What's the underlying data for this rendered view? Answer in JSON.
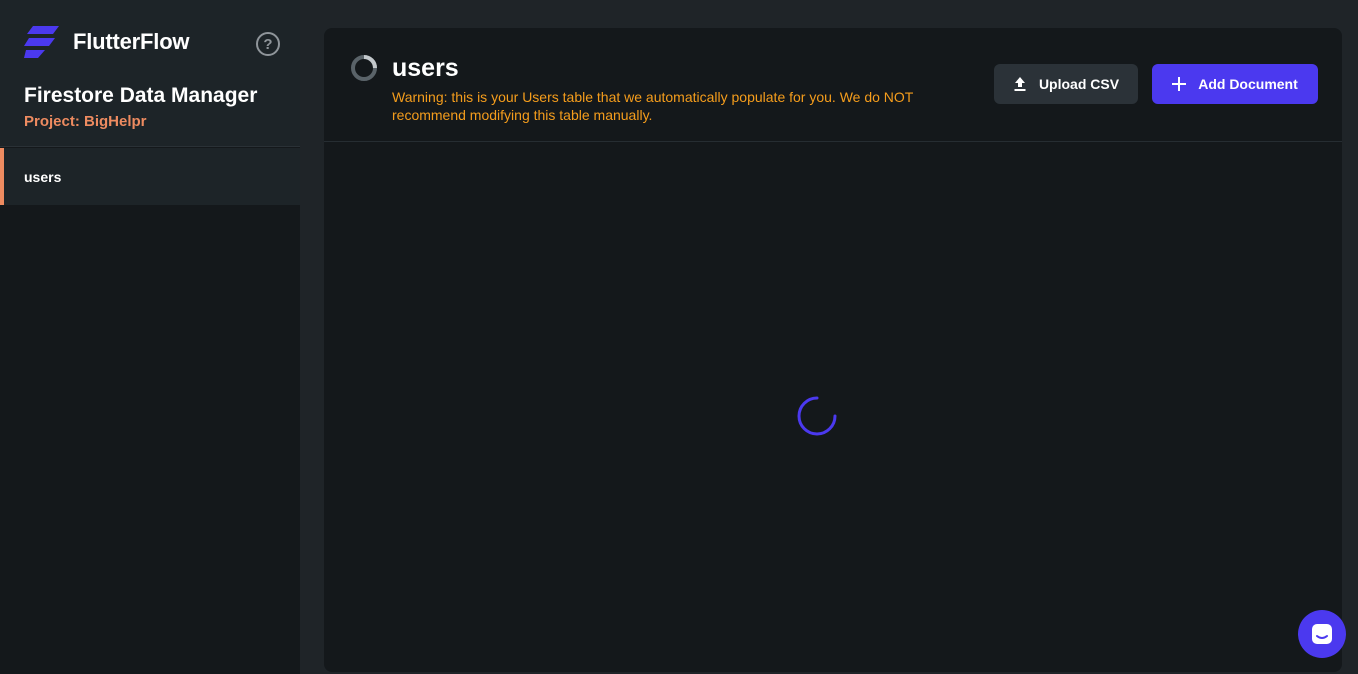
{
  "app": {
    "brand_name": "FlutterFlow",
    "help_icon": "question-circle-icon",
    "help_glyph": "?",
    "manager_title": "Firestore Data Manager",
    "project_label": "Project: BigHelpr"
  },
  "sidebar": {
    "collections": [
      {
        "label": "users",
        "selected": true
      }
    ]
  },
  "main": {
    "table_title": "users",
    "table_icon": "loading-ring-icon",
    "warning": "Warning: this is your Users table that we automatically populate for you. We do NOT recommend modifying this table manually.",
    "buttons": {
      "upload_label": "Upload CSV",
      "upload_icon": "upload-icon",
      "add_label": "Add Document",
      "add_icon": "plus-icon"
    },
    "loading_icon": "loading-spinner-icon"
  },
  "chat": {
    "icon": "chat-icon"
  },
  "colors": {
    "accent": "#4b39ef",
    "project_label": "#ee8b60",
    "warning": "#f59d1c",
    "sidebar_bg": "#14181b",
    "page_bg": "#1f2428"
  }
}
